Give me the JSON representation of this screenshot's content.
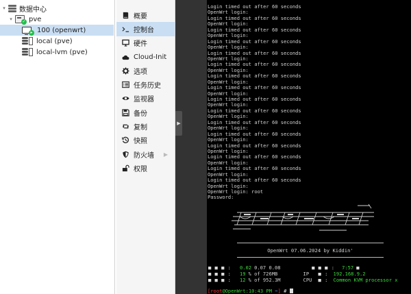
{
  "tree": {
    "datacenter": {
      "label": "数据中心",
      "icon": "datacenter-icon"
    },
    "node": {
      "label": "pve",
      "icon": "server-icon",
      "status": "online"
    },
    "vm": {
      "label": "100 (openwrt)",
      "icon": "vm-icon",
      "status": "running"
    },
    "storages": [
      {
        "label": "local (pve)",
        "icon": "storage-icon"
      },
      {
        "label": "local-lvm (pve)",
        "icon": "storage-icon"
      }
    ]
  },
  "menu": {
    "items": [
      {
        "label": "概要",
        "icon": "book-icon"
      },
      {
        "label": "控制台",
        "icon": "terminal-icon",
        "active": true
      },
      {
        "label": "硬件",
        "icon": "monitor-icon"
      },
      {
        "label": "Cloud-Init",
        "icon": "cloud-icon"
      },
      {
        "label": "选项",
        "icon": "gear-icon"
      },
      {
        "label": "任务历史",
        "icon": "list-icon"
      },
      {
        "label": "监视器",
        "icon": "eye-icon"
      },
      {
        "label": "备份",
        "icon": "floppy-icon"
      },
      {
        "label": "复制",
        "icon": "retweet-icon"
      },
      {
        "label": "快照",
        "icon": "history-icon"
      },
      {
        "label": "防火墙",
        "icon": "shield-icon",
        "has_submenu": true
      },
      {
        "label": "权限",
        "icon": "unlock-icon"
      }
    ]
  },
  "console": {
    "lines": [
      "Login timed out after 60 seconds",
      "OpenWrt login:",
      "Login timed out after 60 seconds",
      "OpenWrt login:",
      "Login timed out after 60 seconds",
      "OpenWrt login:",
      "Login timed out after 60 seconds",
      "OpenWrt login:",
      "Login timed out after 60 seconds",
      "OpenWrt login:",
      "Login timed out after 60 seconds",
      "OpenWrt login:",
      "Login timed out after 60 seconds",
      "OpenWrt login:",
      "Login timed out after 60 seconds",
      "OpenWrt login:",
      "Login timed out after 60 seconds",
      "OpenWrt login:",
      "Login timed out after 60 seconds",
      "OpenWrt login:",
      "Login timed out after 60 seconds",
      "OpenWrt login:",
      "Login timed out after 60 seconds",
      "OpenWrt login:",
      "Login timed out after 60 seconds",
      "OpenWrt login:",
      "Login timed out after 60 seconds",
      "OpenWrt login:",
      "Login timed out after 60 seconds",
      "OpenWrt login:",
      "Login timed out after 60 seconds",
      "OpenWrt login:",
      "OpenWrt login: root",
      "Password:"
    ],
    "banner": "OpenWrt 07.06.2024 by Kiddin'",
    "sysinfo": {
      "load": "0.02",
      "load_rest": "0.07 0.08",
      "mem_pct": "19",
      "mem_text": "% of 726MB",
      "disk_pct": "12",
      "disk_text": "% of 952.3M",
      "time": "7:57",
      "ip_label": "IP",
      "ip": "192.168.9.2",
      "cpu_label": "CPU",
      "cpu": "Common KVM processor x"
    },
    "prompt": {
      "user": "root",
      "host": "OpenWrt",
      "time": "10:43 PM",
      "path": "~"
    },
    "colors": {
      "background": "#000000",
      "text": "#d0d0d0",
      "green": "#3cdc3c",
      "red": "#ff3b3b"
    }
  }
}
